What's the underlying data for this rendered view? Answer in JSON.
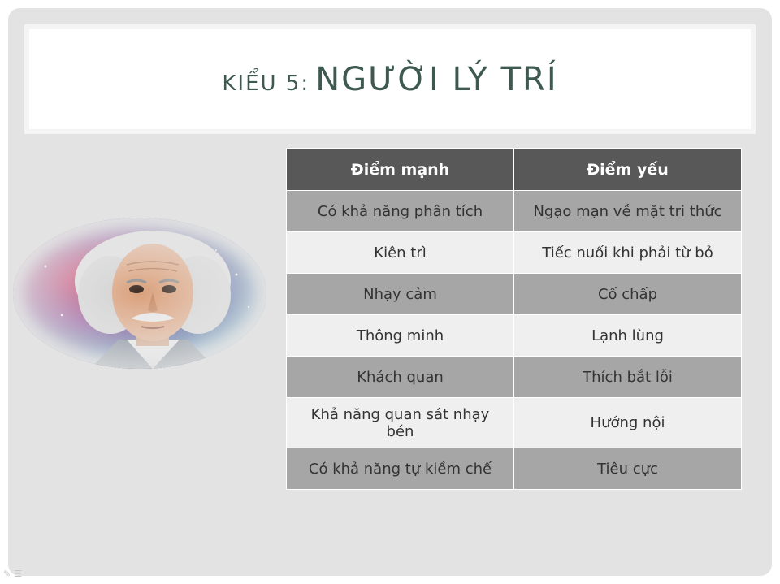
{
  "slide": {
    "title_prefix": "Kiểu 5:",
    "title_main": "Người lý trí"
  },
  "table": {
    "headers": [
      "Điểm mạnh",
      "Điểm yếu"
    ],
    "rows": [
      [
        "Có khả năng phân tích",
        "Ngạo mạn về mặt tri thức"
      ],
      [
        "Kiên trì",
        "Tiếc nuối khi phải từ bỏ"
      ],
      [
        "Nhạy cảm",
        "Cố chấp"
      ],
      [
        "Thông minh",
        "Lạnh lùng"
      ],
      [
        "Khách quan",
        "Thích bắt lỗi"
      ],
      [
        "Khả năng quan sát nhạy bén",
        "Hướng nội"
      ],
      [
        "Có khả năng tự kiềm chế",
        "Tiêu cực"
      ]
    ]
  },
  "colors": {
    "title_text": "#3e5a50",
    "header_bg": "#585858",
    "row_dark": "#a6a6a6",
    "row_light": "#efefef",
    "slide_bg": "#e3e3e3"
  },
  "image": {
    "icon": "portrait-image"
  }
}
